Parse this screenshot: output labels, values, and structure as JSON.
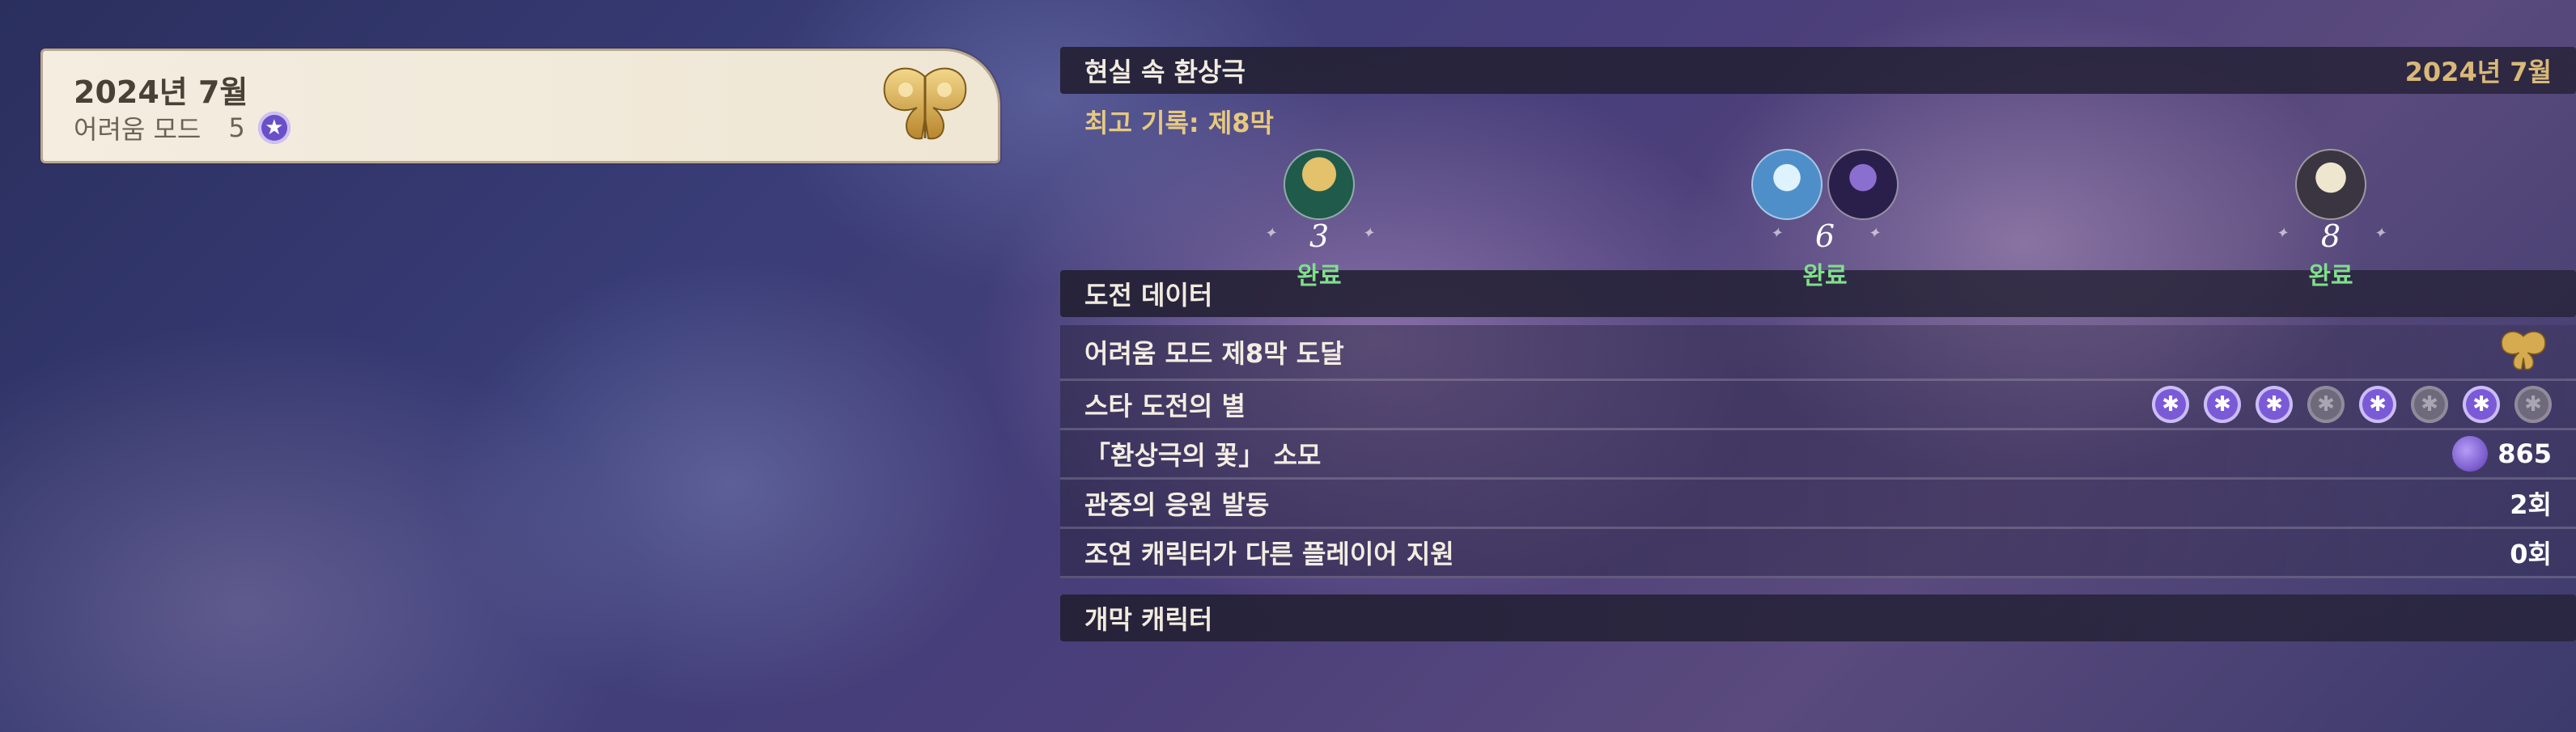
{
  "season": {
    "date": "2024년 7월",
    "mode_label": "어려움 모드",
    "mode_value": "5",
    "star_icon": "★"
  },
  "header": {
    "title": "현실 속 환상극",
    "date": "2024년 7월"
  },
  "best_record": "최고 기록: 제8막",
  "chambers": [
    {
      "numeral": "3",
      "status": "완료"
    },
    {
      "numeral": "6",
      "status": "완료"
    },
    {
      "numeral": "8",
      "status": "완료"
    }
  ],
  "challenge": {
    "title": "도전 데이터",
    "rows": [
      {
        "label": "어려움 모드 제8막 도달",
        "value": ""
      },
      {
        "label": "스타 도전의 별",
        "value": ""
      },
      {
        "label": "「환상극의 꽃」 소모",
        "value": "865"
      },
      {
        "label": "관중의 응원 발동",
        "value": "2회"
      },
      {
        "label": "조연 캐릭터가 다른 플레이어 지원",
        "value": "0회"
      }
    ],
    "stars": [
      1,
      1,
      1,
      0,
      1,
      0,
      1,
      0
    ]
  },
  "cast_title": "개막 캐릭터",
  "colors": {
    "accent_gold": "#e7c97f",
    "complete_green": "#7fe08b",
    "star_purple": "#7b5ad8"
  }
}
